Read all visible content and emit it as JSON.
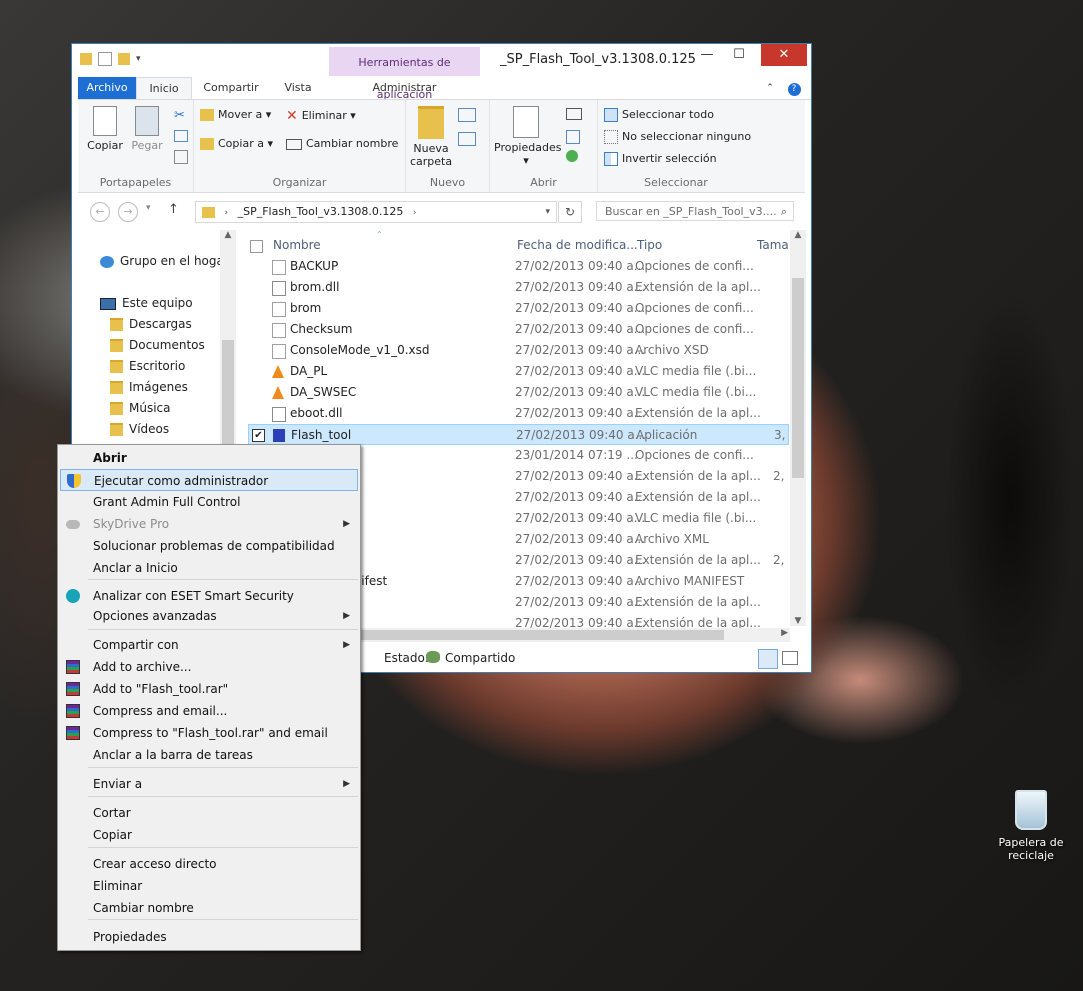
{
  "window": {
    "title": "_SP_Flash_Tool_v3.1308.0.125",
    "context_tab_group": "Herramientas de aplicación",
    "minimize": "—",
    "maximize": "☐",
    "close": "✕"
  },
  "tabs": [
    "Archivo",
    "Inicio",
    "Compartir",
    "Vista",
    "Administrar"
  ],
  "ribbon": {
    "copy": "Copiar",
    "paste": "Pegar",
    "group_clipboard": "Portapapeles",
    "move_to": "Mover a",
    "copy_to": "Copiar a",
    "delete": "Eliminar",
    "rename": "Cambiar nombre",
    "group_organize": "Organizar",
    "new_folder_line1": "Nueva",
    "new_folder_line2": "carpeta",
    "group_new": "Nuevo",
    "properties": "Propiedades",
    "group_open": "Abrir",
    "select_all": "Seleccionar todo",
    "select_none": "No seleccionar ninguno",
    "invert_selection": "Invertir selección",
    "group_select": "Seleccionar"
  },
  "address": {
    "path": "_SP_Flash_Tool_v3.1308.0.125",
    "search_placeholder": "Buscar en _SP_Flash_Tool_v3...."
  },
  "nav": {
    "homegroup": "Grupo en el hogar",
    "this_pc": "Este equipo",
    "items": [
      "Descargas",
      "Documentos",
      "Escritorio",
      "Imágenes",
      "Música",
      "Vídeos"
    ]
  },
  "columns": {
    "name": "Nombre",
    "date": "Fecha de modifica...",
    "type": "Tipo",
    "size": "Tama"
  },
  "files": [
    {
      "name": "BACKUP",
      "date": "27/02/2013 09:40 a...",
      "type": "Opciones de confi...",
      "size": ""
    },
    {
      "name": "brom.dll",
      "date": "27/02/2013 09:40 a...",
      "type": "Extensión de la apl...",
      "size": ""
    },
    {
      "name": "brom",
      "date": "27/02/2013 09:40 a...",
      "type": "Opciones de confi...",
      "size": ""
    },
    {
      "name": "Checksum",
      "date": "27/02/2013 09:40 a...",
      "type": "Opciones de confi...",
      "size": ""
    },
    {
      "name": "ConsoleMode_v1_0.xsd",
      "date": "27/02/2013 09:40 a...",
      "type": "Archivo XSD",
      "size": ""
    },
    {
      "name": "DA_PL",
      "date": "27/02/2013 09:40 a...",
      "type": "VLC media file (.bi...",
      "size": ""
    },
    {
      "name": "DA_SWSEC",
      "date": "27/02/2013 09:40 a...",
      "type": "VLC media file (.bi...",
      "size": ""
    },
    {
      "name": "eboot.dll",
      "date": "27/02/2013 09:40 a...",
      "type": "Extensión de la apl...",
      "size": ""
    },
    {
      "name": "Flash_tool",
      "date": "27/02/2013 09:40 a...",
      "type": "Aplicación",
      "size": "3,"
    },
    {
      "name": "",
      "date": "23/01/2014 07:19 ...",
      "type": "Opciones de confi...",
      "size": ""
    },
    {
      "name": "dll",
      "date": "27/02/2013 09:40 a...",
      "type": "Extensión de la apl...",
      "size": "2,"
    },
    {
      "name": "",
      "date": "27/02/2013 09:40 a...",
      "type": "Extensión de la apl...",
      "size": ""
    },
    {
      "name": "",
      "date": "27/02/2013 09:40 a...",
      "type": "VLC media file (.bi...",
      "size": ""
    },
    {
      "name": "",
      "date": "27/02/2013 09:40 a...",
      "type": "Archivo XML",
      "size": ""
    },
    {
      "name": "l",
      "date": "27/02/2013 09:40 a...",
      "type": "Extensión de la apl...",
      "size": "2,"
    },
    {
      "name": "90.CRT.manifest",
      "date": "27/02/2013 09:40 a...",
      "type": "Archivo MANIFEST",
      "size": ""
    },
    {
      "name": "",
      "date": "27/02/2013 09:40 a...",
      "type": "Extensión de la apl...",
      "size": ""
    },
    {
      "name": "",
      "date": "27/02/2013 09:40 a...",
      "type": "Extensión de la apl...",
      "size": ""
    }
  ],
  "status": {
    "label": "Estado:",
    "value": "Compartido"
  },
  "context_menu": [
    {
      "label": "Abrir",
      "bold": true
    },
    {
      "label": "Ejecutar como administrador",
      "highlight": true,
      "icon": "shield-icon"
    },
    {
      "label": "Grant Admin Full Control"
    },
    {
      "label": "SkyDrive Pro",
      "disabled": true,
      "submenu": true,
      "icon": "cloud-icon"
    },
    {
      "label": "Solucionar problemas de compatibilidad"
    },
    {
      "label": "Anclar a Inicio"
    },
    {
      "label": "Analizar con ESET Smart Security",
      "icon": "eset-icon"
    },
    {
      "label": "Opciones avanzadas",
      "submenu": true
    },
    {
      "label": "Compartir con",
      "submenu": true
    },
    {
      "label": "Add to archive...",
      "icon": "winrar-icon"
    },
    {
      "label": "Add to \"Flash_tool.rar\"",
      "icon": "winrar-icon"
    },
    {
      "label": "Compress and email...",
      "icon": "winrar-icon"
    },
    {
      "label": "Compress to \"Flash_tool.rar\" and email",
      "icon": "winrar-icon"
    },
    {
      "label": "Anclar a la barra de tareas"
    },
    {
      "label": "Enviar a",
      "submenu": true
    },
    {
      "label": "Cortar"
    },
    {
      "label": "Copiar"
    },
    {
      "label": "Crear acceso directo"
    },
    {
      "label": "Eliminar"
    },
    {
      "label": "Cambiar nombre"
    },
    {
      "label": "Propiedades"
    }
  ],
  "desktop": {
    "recycle_bin_line1": "Papelera de",
    "recycle_bin_line2": "reciclaje"
  },
  "colors": {
    "accent": "#1d6fd3",
    "selection": "#cce8ff",
    "close": "#c7372b",
    "tool_tab": "#e9d6f2"
  }
}
